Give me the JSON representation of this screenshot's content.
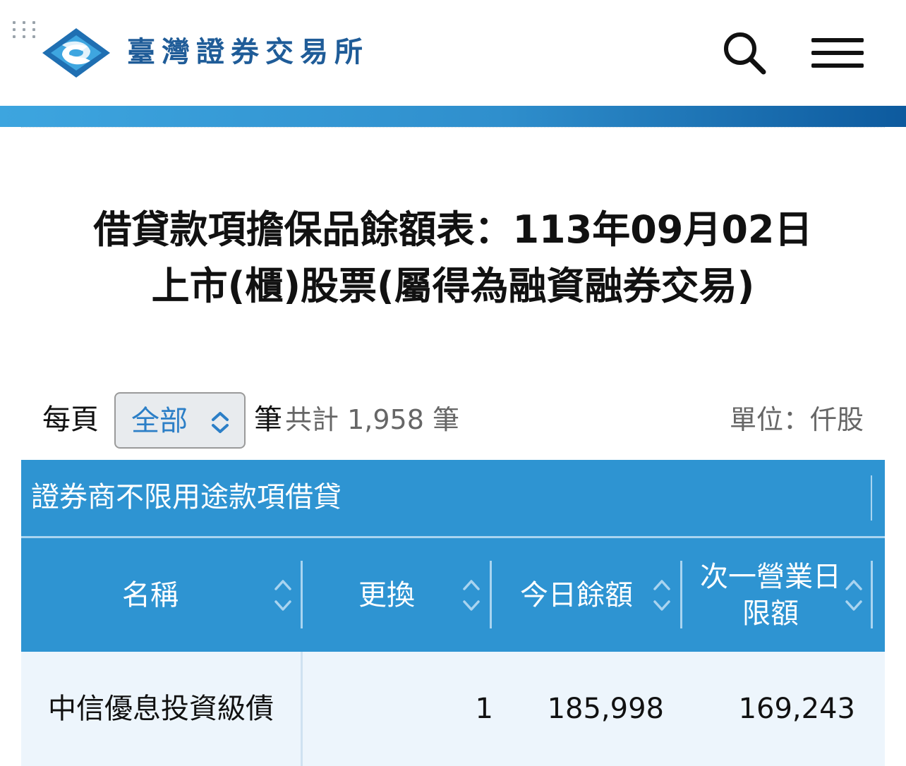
{
  "header": {
    "brand_name": "臺灣證券交易所",
    "brand_color": "#1f5c98",
    "logo_icon": "twse-logo-icon",
    "search_icon": "search-icon",
    "menu_icon": "hamburger-menu-icon"
  },
  "title": {
    "line1": "借貸款項擔保品餘額表：113年09月02日",
    "line2": "上市(櫃)股票(屬得為融資融券交易)"
  },
  "toolbar": {
    "per_page_label": "每頁",
    "per_page_value": "全部",
    "per_page_suffix": "筆",
    "total_text": "共計 1,958 筆",
    "unit_text": "單位：仟股"
  },
  "table": {
    "caption": "證券商不限用途款項借貸",
    "header_color": "#2e94d2",
    "columns": [
      "名稱",
      "更換",
      "今日餘額",
      "次一營業日限額"
    ],
    "rows": [
      [
        "中信優息投資級債",
        "1",
        "185,998",
        "169,243"
      ]
    ]
  }
}
